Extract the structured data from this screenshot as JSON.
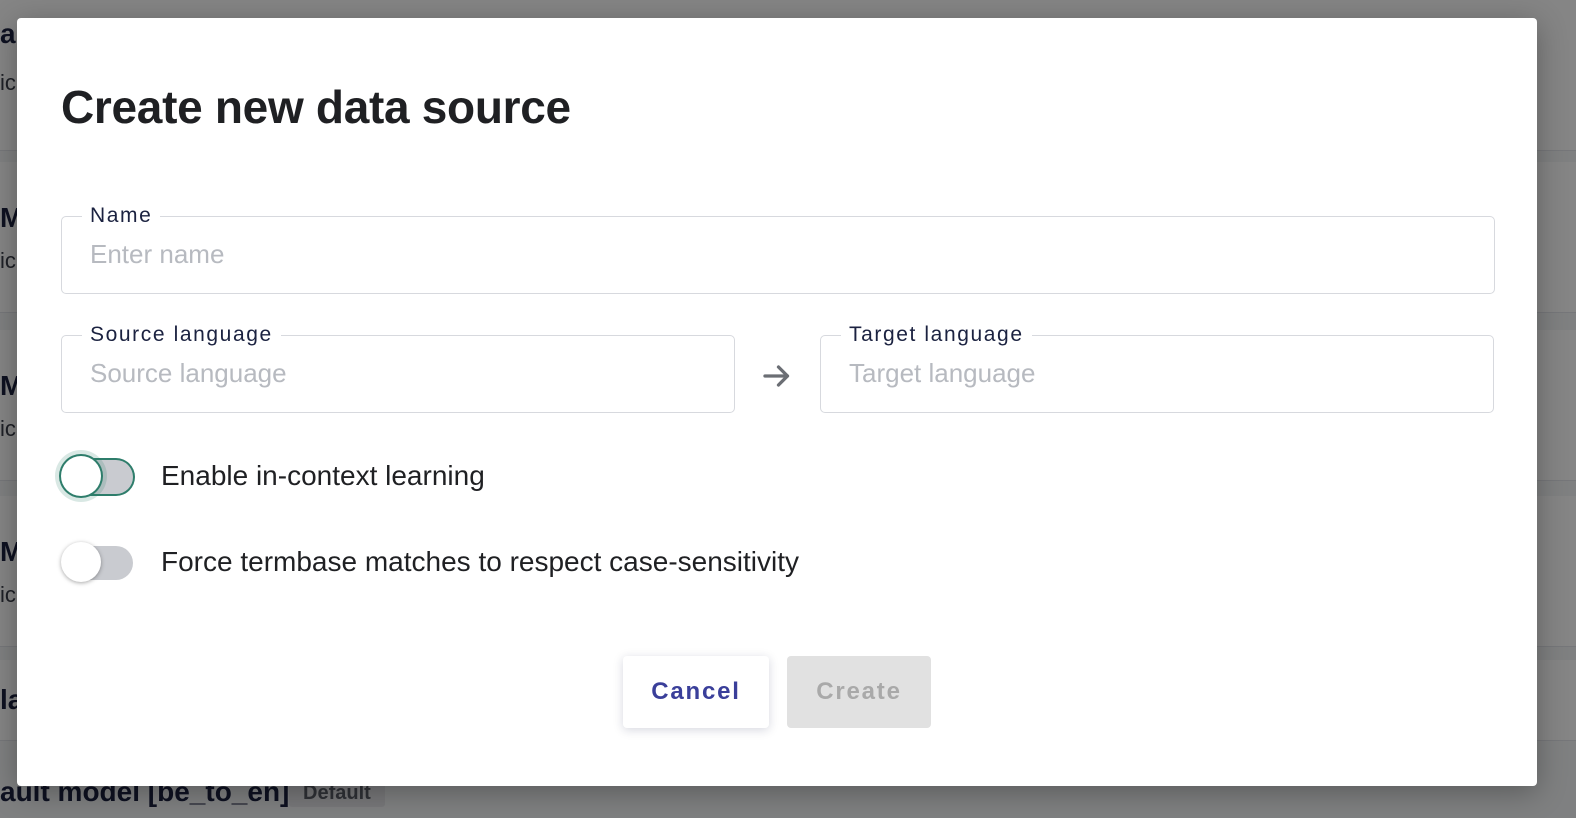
{
  "background": {
    "cards": [
      {
        "title": "au",
        "subtitle": "ic"
      },
      {
        "title": "MC",
        "subtitle": "ic"
      },
      {
        "title": "MC",
        "subtitle": "ic"
      },
      {
        "title": "MC",
        "subtitle": "ic"
      },
      {
        "title": "la",
        "subtitle": ""
      }
    ],
    "bottom_item": {
      "title": "ault model [be_to_en]",
      "badge": "Default"
    }
  },
  "modal": {
    "title": "Create new data source",
    "name_field": {
      "label": "Name",
      "placeholder": "Enter name",
      "value": ""
    },
    "source_field": {
      "label": "Source language",
      "placeholder": "Source language",
      "value": ""
    },
    "target_field": {
      "label": "Target language",
      "placeholder": "Target language",
      "value": ""
    },
    "arrow_icon": "arrow-right-icon",
    "toggles": [
      {
        "label": "Enable in-context learning",
        "checked": false,
        "focused": true
      },
      {
        "label": "Force termbase matches to respect case-sensitivity",
        "checked": false,
        "focused": false
      }
    ],
    "buttons": {
      "cancel": "Cancel",
      "create": "Create",
      "create_disabled": true
    }
  },
  "colors": {
    "overlay": "#7a7a7a",
    "title_text": "#1f2023",
    "label_text": "#1b2240",
    "cancel_text": "#3a3f9a",
    "create_bg": "#e1e1e1",
    "focus_ring": "#2e7d6b"
  }
}
